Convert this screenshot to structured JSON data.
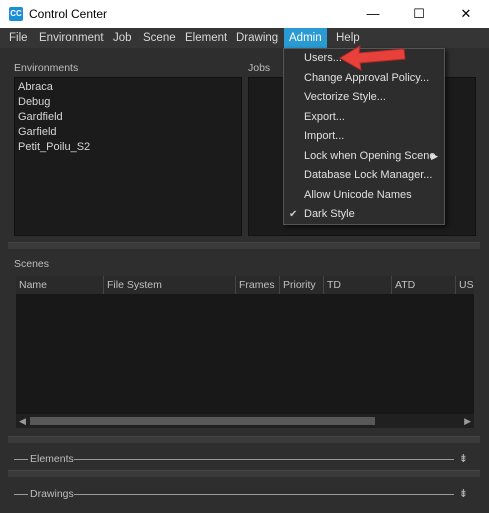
{
  "window": {
    "app_icon": "CC",
    "title": "Control Center",
    "minimize": "—",
    "maximize": "☐",
    "close": "✕"
  },
  "menubar": {
    "items": [
      "File",
      "Environment",
      "Job",
      "Scene",
      "Element",
      "Drawing",
      "Admin",
      "Help"
    ],
    "active": "Admin"
  },
  "environments": {
    "label": "Environments",
    "items": [
      "Abraca",
      "Debug",
      "Gardfield",
      "Garfield",
      "Petit_Poilu_S2"
    ]
  },
  "jobs": {
    "label": "Jobs"
  },
  "scenes": {
    "label": "Scenes",
    "columns": [
      "Name",
      "File System",
      "Frames",
      "Priority",
      "TD",
      "ATD",
      "USE"
    ]
  },
  "elements": {
    "label": "Elements",
    "knob": "⇟"
  },
  "drawings": {
    "label": "Drawings",
    "knob": "⇟"
  },
  "admin_menu": {
    "items": [
      "Users...",
      "Change Approval Policy...",
      "Vectorize Style...",
      "Export...",
      "Import...",
      "Lock when Opening Scene",
      "Database Lock Manager...",
      "Allow Unicode Names",
      "Dark Style"
    ],
    "submenu_arrow": "▶",
    "checked_item": "Dark Style",
    "check_mark": "✔"
  },
  "annotation": {
    "arrow_color": "#e8403a"
  }
}
